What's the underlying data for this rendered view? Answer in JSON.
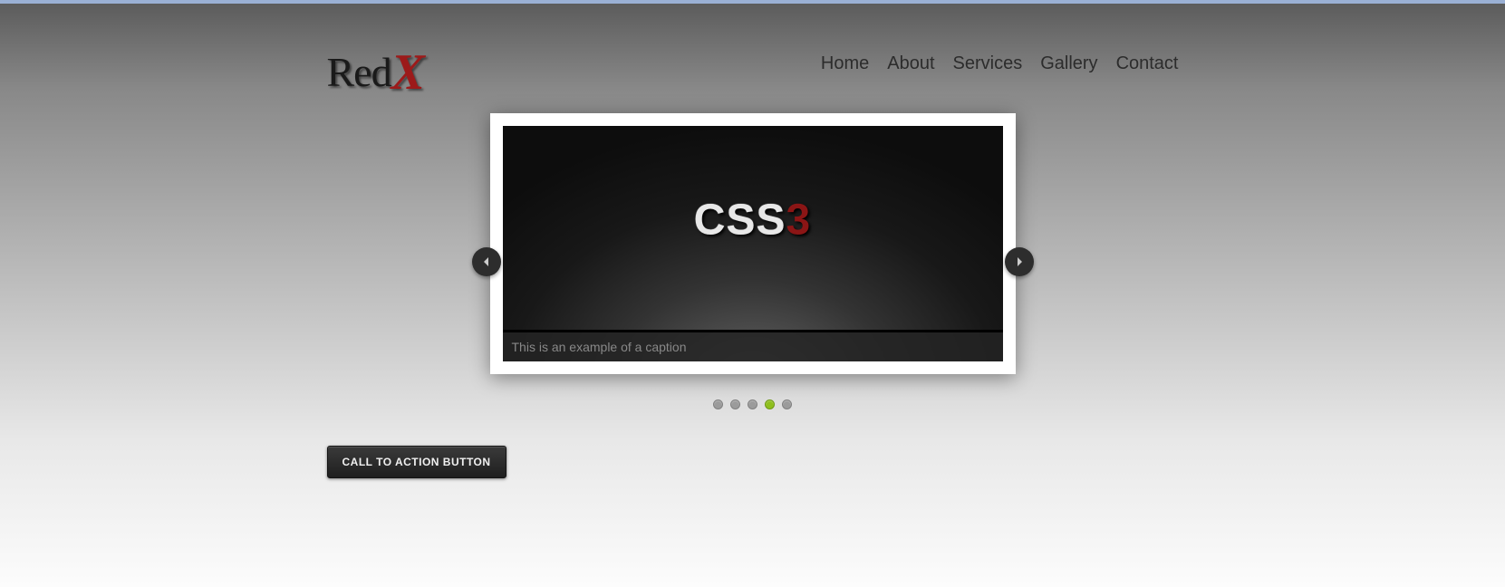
{
  "logo": {
    "part1": "Red",
    "part2": "X"
  },
  "nav": {
    "items": [
      {
        "label": "Home"
      },
      {
        "label": "About"
      },
      {
        "label": "Services"
      },
      {
        "label": "Gallery"
      },
      {
        "label": "Contact"
      }
    ]
  },
  "slider": {
    "slide_text_main": "CSS",
    "slide_text_accent": "3",
    "caption": "This is an example of a caption",
    "dot_count": 5,
    "active_dot_index": 3
  },
  "cta": {
    "label": "CALL TO ACTION BUTTON"
  }
}
